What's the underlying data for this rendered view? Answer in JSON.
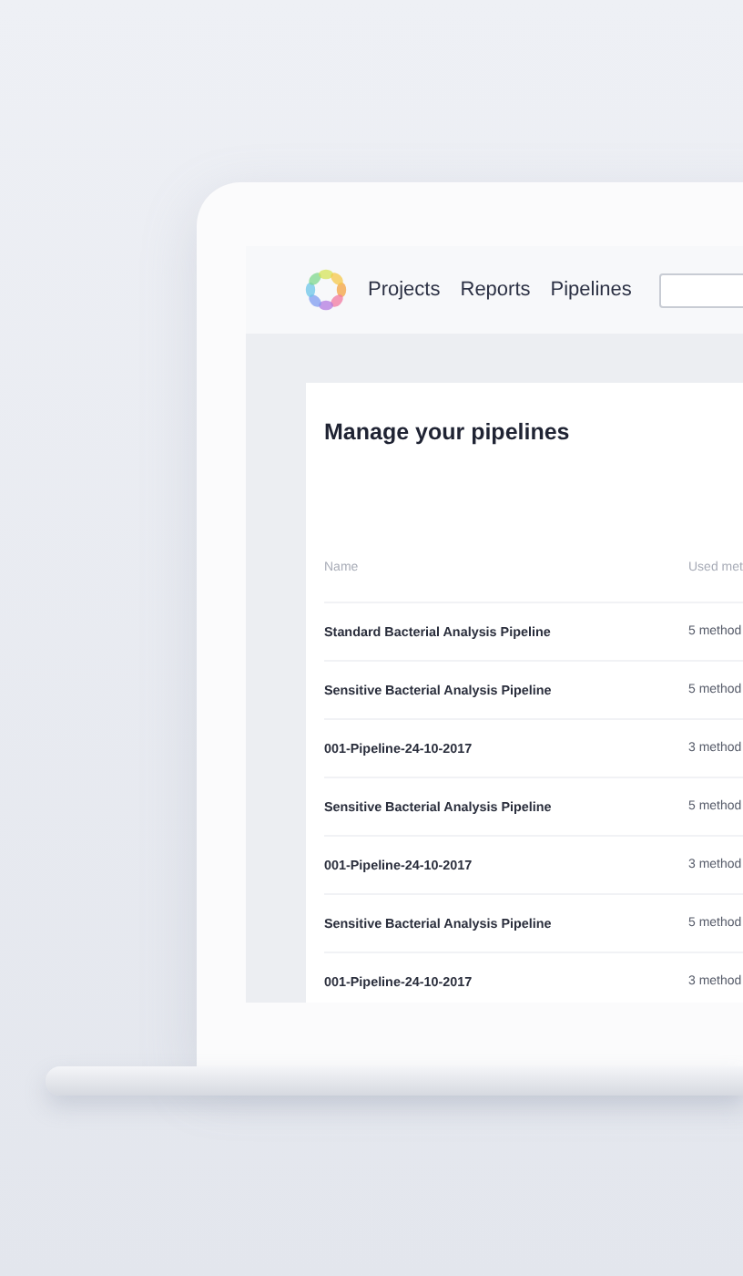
{
  "nav": {
    "items": [
      {
        "label": "Projects"
      },
      {
        "label": "Reports"
      },
      {
        "label": "Pipelines"
      }
    ]
  },
  "page": {
    "title": "Manage your pipelines"
  },
  "table": {
    "columns": [
      "Name",
      "Used met"
    ],
    "rows": [
      {
        "name": "Standard Bacterial Analysis Pipeline",
        "methods": "5 method"
      },
      {
        "name": "Sensitive Bacterial Analysis Pipeline",
        "methods": "5 method"
      },
      {
        "name": "001-Pipeline-24-10-2017",
        "methods": "3 method"
      },
      {
        "name": "Sensitive Bacterial Analysis Pipeline",
        "methods": "5 method"
      },
      {
        "name": "001-Pipeline-24-10-2017",
        "methods": "3 method"
      },
      {
        "name": "Sensitive Bacterial Analysis Pipeline",
        "methods": "5 method"
      },
      {
        "name": "001-Pipeline-24-10-2017",
        "methods": "3 method"
      }
    ]
  }
}
